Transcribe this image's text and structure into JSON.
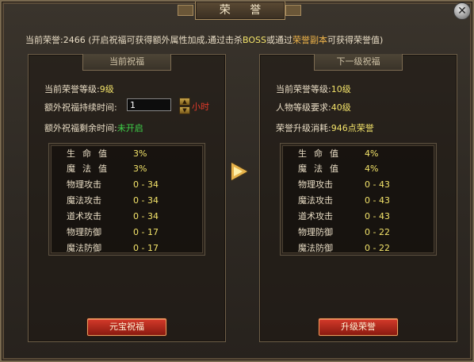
{
  "window": {
    "title": "荣 誉",
    "close_label": "✕"
  },
  "header": {
    "prefix": "当前荣誉:2466  (开启祝福可获得额外属性加成,通过击杀",
    "boss": "BOSS",
    "mid": "或通过",
    "dungeon": "荣誉副本",
    "suffix": "可获得荣誉值)"
  },
  "left_panel": {
    "heading": "当前祝福",
    "level_label": "当前荣誉等级:",
    "level_value": "9级",
    "duration_label": "额外祝福持续时间:",
    "duration_input": "1",
    "duration_unit": "小时",
    "remaining_label": "额外祝福剩余时间:",
    "remaining_value": "未开启",
    "stats": [
      {
        "name": "生命值",
        "value": "3%"
      },
      {
        "name": "魔法值",
        "value": "3%"
      },
      {
        "name": "物理攻击",
        "value": "0 - 34"
      },
      {
        "name": "魔法攻击",
        "value": "0 - 34"
      },
      {
        "name": "道术攻击",
        "value": "0 - 34"
      },
      {
        "name": "物理防御",
        "value": "0 - 17"
      },
      {
        "name": "魔法防御",
        "value": "0 - 17"
      }
    ],
    "button_label": "元宝祝福"
  },
  "right_panel": {
    "heading": "下一级祝福",
    "level_label": "当前荣誉等级:",
    "level_value": "10级",
    "req_label": "人物等级要求:",
    "req_value": "40级",
    "cost_label": "荣誉升级消耗:",
    "cost_value": "946点荣誉",
    "stats": [
      {
        "name": "生命值",
        "value": "4%"
      },
      {
        "name": "魔法值",
        "value": "4%"
      },
      {
        "name": "物理攻击",
        "value": "0 - 43"
      },
      {
        "name": "魔法攻击",
        "value": "0 - 43"
      },
      {
        "name": "道术攻击",
        "value": "0 - 43"
      },
      {
        "name": "物理防御",
        "value": "0 - 22"
      },
      {
        "name": "魔法防御",
        "value": "0 - 22"
      }
    ],
    "button_label": "升级荣誉"
  },
  "icons": {
    "close": "close-icon",
    "arrow": "arrow-right-icon",
    "stepper_up": "chevron-up-icon",
    "stepper_down": "chevron-down-icon"
  },
  "colors": {
    "value_yellow": "#f3e36a",
    "status_green": "#3fd24a",
    "unit_red": "#e23a2a",
    "button_red": "#c42a1e",
    "arrow_gold": "#e6b24a"
  }
}
